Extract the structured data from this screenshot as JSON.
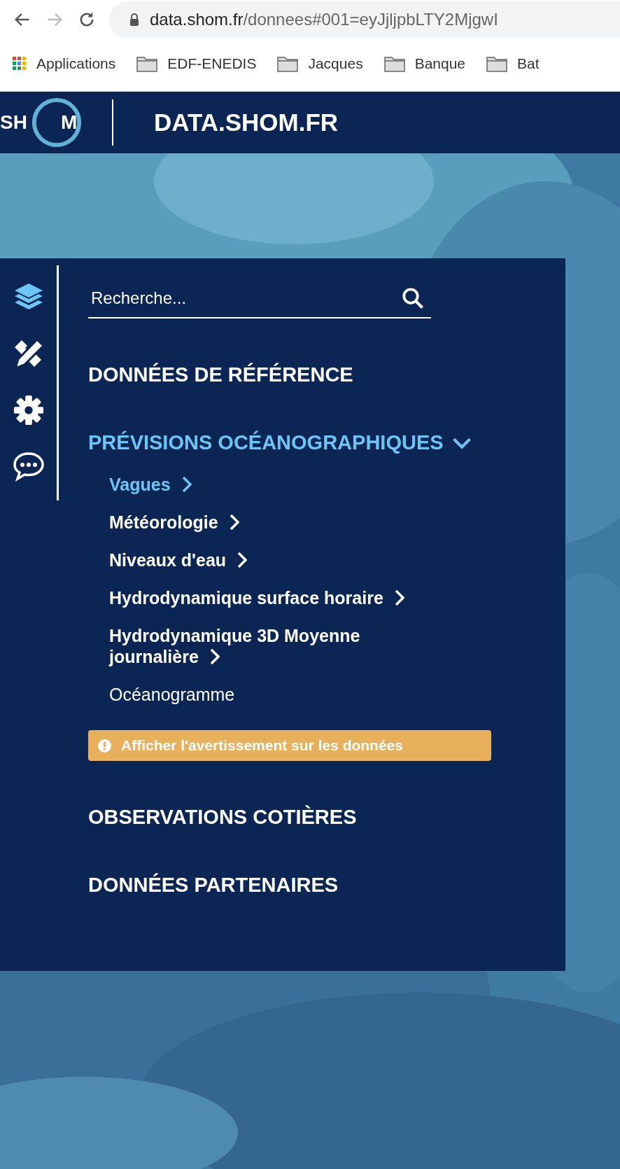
{
  "browser": {
    "url_host": "data.shom.fr",
    "url_path": "/donnees#001=eyJjljpbLTY2MjgwI",
    "back_disabled": false,
    "forward_disabled": true,
    "bookmarks": [
      {
        "label": "Applications",
        "kind": "apps"
      },
      {
        "label": "EDF-ENEDIS",
        "kind": "folder"
      },
      {
        "label": "Jacques",
        "kind": "folder"
      },
      {
        "label": "Banque",
        "kind": "folder"
      },
      {
        "label": "Bat",
        "kind": "folder"
      }
    ]
  },
  "header": {
    "logo_left": "SH",
    "logo_right": "M",
    "title": "DATA.SHOM.FR"
  },
  "toolbar": [
    {
      "kind": "layers",
      "selected": true
    },
    {
      "kind": "tools",
      "selected": false
    },
    {
      "kind": "settings",
      "selected": false
    },
    {
      "kind": "chat",
      "selected": false
    }
  ],
  "search": {
    "placeholder": "Recherche..."
  },
  "sections": [
    {
      "label": "DONNÉES DE RÉFÉRENCE",
      "expanded": false,
      "selected": false
    },
    {
      "label": "PRÉVISIONS OCÉANOGRAPHIQUES",
      "expanded": true,
      "selected": true,
      "children": [
        {
          "label": "Vagues",
          "selected": true,
          "has_submenu": true
        },
        {
          "label": "Météorologie",
          "selected": false,
          "has_submenu": true
        },
        {
          "label": "Niveaux d'eau",
          "selected": false,
          "has_submenu": true
        },
        {
          "label": "Hydrodynamique surface horaire",
          "selected": false,
          "has_submenu": true
        },
        {
          "label": "Hydrodynamique 3D Moyenne journalière",
          "selected": false,
          "has_submenu": true
        },
        {
          "label": "Océanogramme",
          "selected": false,
          "has_submenu": false
        }
      ],
      "warning": "Afficher l'avertissement sur les données"
    },
    {
      "label": "OBSERVATIONS COTIÈRES",
      "expanded": false,
      "selected": false
    },
    {
      "label": "DONNÉES PARTENAIRES",
      "expanded": false,
      "selected": false
    }
  ]
}
